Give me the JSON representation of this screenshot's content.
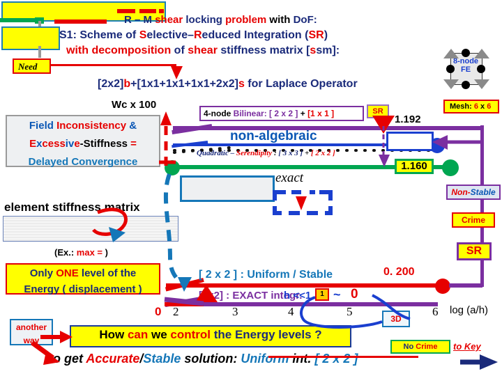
{
  "header": {
    "line1_parts": [
      {
        "t": "R – M ",
        "c": "navy"
      },
      {
        "t": "shear ",
        "c": "red"
      },
      {
        "t": "locking ",
        "c": "navy"
      },
      {
        "t": "problem ",
        "c": "red"
      },
      {
        "t": "with ",
        "c": "black"
      },
      {
        "t": "DoF:",
        "c": "navy"
      }
    ],
    "line2_parts": [
      {
        "t": "S1: Scheme of ",
        "c": "navy"
      },
      {
        "t": "S",
        "c": "red"
      },
      {
        "t": "elective–",
        "c": "navy"
      },
      {
        "t": "R",
        "c": "red"
      },
      {
        "t": "educed Integration (",
        "c": "navy"
      },
      {
        "t": "SR",
        "c": "red"
      },
      {
        "t": ")",
        "c": "navy"
      }
    ],
    "line3_parts": [
      {
        "t": "with ",
        "c": "red"
      },
      {
        "t": "decomposition ",
        "c": "red"
      },
      {
        "t": "of ",
        "c": "navy"
      },
      {
        "t": "shear ",
        "c": "red"
      },
      {
        "t": "stiffness matrix [",
        "c": "navy"
      },
      {
        "t": "s",
        "c": "red"
      },
      {
        "t": "sm]:",
        "c": "navy"
      }
    ],
    "line4_parts": [
      {
        "t": "[2x2]",
        "c": "navy"
      },
      {
        "t": "b",
        "c": "red"
      },
      {
        "t": "+[1x1+1x1+1x1+2x2]",
        "c": "navy"
      },
      {
        "t": "s",
        "c": "red"
      },
      {
        "t": "  for Laplace Operator",
        "c": "navy"
      }
    ],
    "need_label": "Need"
  },
  "fe_widget": {
    "label_line1": "8-node",
    "label_line2": "FE",
    "mesh_parts": [
      {
        "t": "Mesh: ",
        "c": "black"
      },
      {
        "t": "6",
        "c": "red"
      },
      {
        "t": " x ",
        "c": "black"
      },
      {
        "t": "6",
        "c": "red"
      }
    ]
  },
  "field_panel": {
    "line1_parts": [
      {
        "t": "Field ",
        "c": "blue"
      },
      {
        "t": "Inconsistency ",
        "c": "red"
      },
      {
        "t": "&",
        "c": "blue"
      }
    ],
    "line2_parts": [
      {
        "t": "E",
        "c": "red"
      },
      {
        "t": "x",
        "c": "blue"
      },
      {
        "t": "cess",
        "c": "red"
      },
      {
        "t": "iv",
        "c": "blue"
      },
      {
        "t": "e",
        "c": "red"
      },
      {
        "t": "-Stiffness ",
        "c": "black"
      },
      {
        "t": "=",
        "c": "red"
      }
    ],
    "line3_parts": [
      {
        "t": "Delayed Convergence",
        "c": "teal"
      }
    ]
  },
  "chart_data": {
    "type": "line",
    "title": "Wc x 100",
    "xlabel": "log (a/h)",
    "ylabel": "Wc x 100",
    "x_ticks": [
      "2",
      "3",
      "4",
      "5",
      "6"
    ],
    "xlim": [
      2,
      6
    ],
    "origin_label": "0",
    "series": [
      {
        "name": "4-node Bilinear: [ 2 x 2 ] + [1 x 1]",
        "color": "#7b2fa0",
        "end_value": 1.192,
        "style": "solid",
        "annotation": "non-algebraic"
      },
      {
        "name": "Quadratic – Serendipity : [ 3 x 3 ] + [ 2 x 2 ]",
        "color": "#1a3fcf",
        "end_value": 1.192,
        "style": "solid-with-dots"
      },
      {
        "name": "exact",
        "color": "#00a651",
        "end_value": 1.16,
        "style": "solid"
      },
      {
        "name": "[ 2 x 2 ] : Uniform / Stable",
        "color": "#e60000",
        "end_value": 0.2,
        "style": "solid"
      },
      {
        "name": "[2x2] : EXACT integr.",
        "color": "#7b2fa0",
        "end_value": 0.0,
        "style": "solid"
      }
    ],
    "value_labels": [
      "1.192",
      "1.160",
      "0. 200"
    ]
  },
  "chart_labels": {
    "wc": "Wc x 100",
    "bilinear_parts": [
      {
        "t": "4-node ",
        "c": "black"
      },
      {
        "t": "Bilinear: ",
        "c": "purple"
      },
      {
        "t": "[ 2 x 2 ] ",
        "c": "purple"
      },
      {
        "t": "+ ",
        "c": "black"
      },
      {
        "t": "[1 x 1 ]",
        "c": "red"
      }
    ],
    "sr_badge_1": "SR",
    "non_algebraic": "non-algebraic",
    "quadratic_parts": [
      {
        "t": "Quadratic – ",
        "c": "navy"
      },
      {
        "t": "Serendipity",
        "c": "red"
      },
      {
        "t": " : ",
        "c": "black"
      },
      {
        "t": "[ 3 x 3 ] ",
        "c": "navy"
      },
      {
        "t": "+ ",
        "c": "black"
      },
      {
        "t": "[ 2 x 2 ]",
        "c": "red"
      }
    ],
    "exact": "exact",
    "v_1192": "1.192",
    "v_1160": "1.160",
    "v_0200": "0. 200",
    "uniform_stable": "[ 2 x 2 ] : Uniform / Stable",
    "exact_integr": "[2x2] : EXACT integr.",
    "h_small": "h <<1",
    "cube_label": "1",
    "tilde": "~",
    "near_zero": "0",
    "box_3d": "3D",
    "axis_x_label": "log (a/h)",
    "origin": "0",
    "ticks": [
      "2",
      "3",
      "4",
      "5",
      "6"
    ]
  },
  "stiffness": {
    "title": "element stiffness matrix",
    "ex_parts": [
      {
        "t": "(Ex.: ",
        "c": "black"
      },
      {
        "t": "max = ",
        "c": "red"
      },
      {
        "t": "          )",
        "c": "black"
      }
    ]
  },
  "only_one": {
    "line1_parts": [
      {
        "t": "Only ",
        "c": "navy"
      },
      {
        "t": "ONE ",
        "c": "red"
      },
      {
        "t": "level of the",
        "c": "navy"
      }
    ],
    "line2_parts": [
      {
        "t": "Energy ( displacement )",
        "c": "navy"
      }
    ]
  },
  "right_column": {
    "non_stable_parts": [
      {
        "t": "Non-",
        "c": "red"
      },
      {
        "t": "Stable",
        "c": "blue"
      }
    ],
    "crime": "Crime",
    "sr": "SR"
  },
  "footer": {
    "another_way_line1": "another",
    "another_way_line2": "way",
    "how_parts": [
      {
        "t": "How ",
        "c": "black"
      },
      {
        "t": "can ",
        "c": "red"
      },
      {
        "t": "we ",
        "c": "black"
      },
      {
        "t": "control ",
        "c": "red"
      },
      {
        "t": "the Energy levels ?",
        "c": "navy"
      }
    ],
    "to_get_parts": [
      {
        "t": "to get ",
        "c": "black"
      },
      {
        "t": "Accurate",
        "c": "red"
      },
      {
        "t": "/",
        "c": "black"
      },
      {
        "t": "Stable ",
        "c": "teal"
      },
      {
        "t": "solution: ",
        "c": "black"
      },
      {
        "t": "Uniform ",
        "c": "teal"
      },
      {
        "t": "int. ",
        "c": "black"
      },
      {
        "t": "[ 2 x 2 ]",
        "c": "teal"
      }
    ],
    "no_crime_parts": [
      {
        "t": "No ",
        "c": "navy"
      },
      {
        "t": "Crime",
        "c": "red"
      }
    ],
    "to_key": "to Key"
  }
}
